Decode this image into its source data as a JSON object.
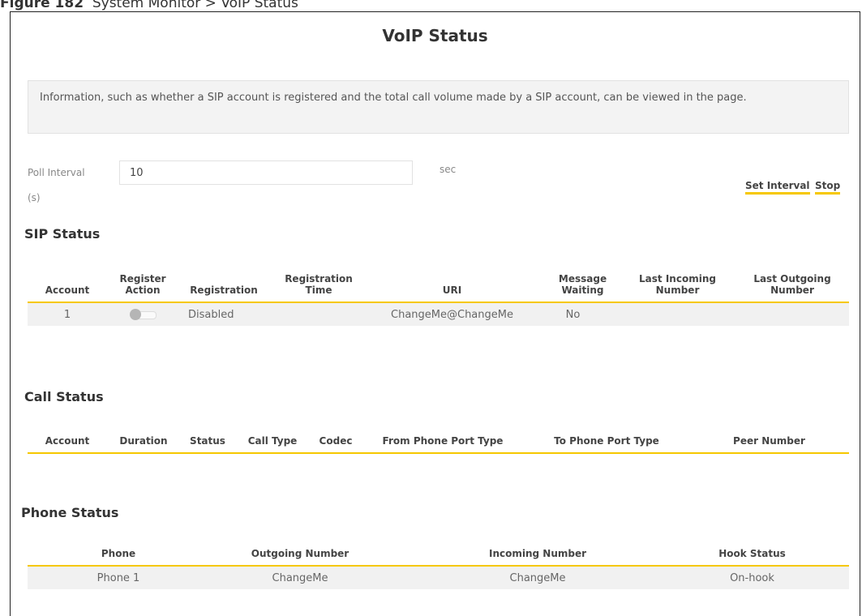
{
  "figure_caption": {
    "label": "Figure 182",
    "text": "System Monitor > VoIP Status"
  },
  "page_title": "VoIP Status",
  "info_text": "Information, such as whether a SIP account is registered and the total call volume made by a SIP account, can be viewed in the page.",
  "poll": {
    "label_line1": "Poll Interval",
    "label_line2": "(s)",
    "value": "10",
    "unit": "sec",
    "set_interval_label": "Set Interval",
    "stop_label": "Stop"
  },
  "colors": {
    "accent": "#f6c800",
    "row_bg": "#f1f1f1"
  },
  "sip_status": {
    "title": "SIP Status",
    "headers": [
      "Account",
      "Register Action",
      "Registration",
      "Registration Time",
      "URI",
      "Message Waiting",
      "Last Incoming Number",
      "Last Outgoing Number"
    ],
    "rows": [
      {
        "account": "1",
        "register_action": "off",
        "registration": "Disabled",
        "registration_time": "",
        "uri": "ChangeMe@ChangeMe",
        "message_waiting": "No",
        "last_incoming": "",
        "last_outgoing": ""
      }
    ]
  },
  "call_status": {
    "title": "Call Status",
    "headers": [
      "Account",
      "Duration",
      "Status",
      "Call Type",
      "Codec",
      "From Phone Port Type",
      "To Phone Port Type",
      "Peer Number"
    ]
  },
  "phone_status": {
    "title": "Phone Status",
    "headers": [
      "Phone",
      "Outgoing Number",
      "Incoming Number",
      "Hook Status"
    ],
    "rows": [
      {
        "phone": "Phone 1",
        "outgoing": "ChangeMe",
        "incoming": "ChangeMe",
        "hook": "On-hook"
      }
    ]
  }
}
